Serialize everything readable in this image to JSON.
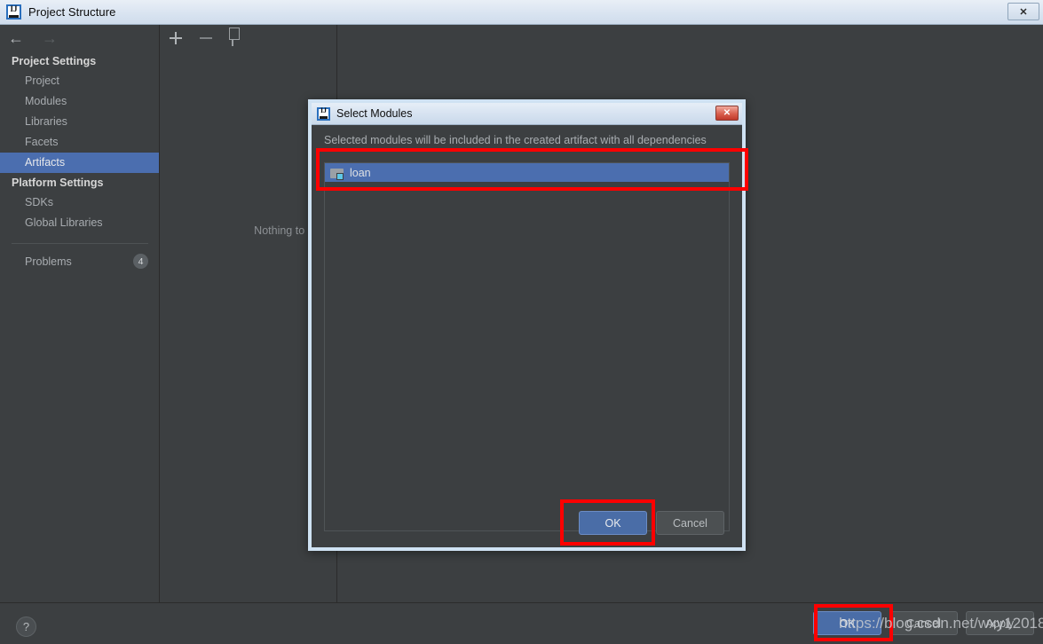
{
  "window": {
    "title": "Project Structure",
    "logo_icon": "intellij-idea-logo-icon",
    "close_icon": "close-icon",
    "close_label": "✕"
  },
  "sidebar": {
    "back_icon": "arrow-left-icon",
    "forward_icon": "arrow-right-icon",
    "back_label": "←",
    "forward_label": "→",
    "groups": [
      {
        "title": "Project Settings",
        "items": [
          {
            "label": "Project",
            "selected": false
          },
          {
            "label": "Modules",
            "selected": false
          },
          {
            "label": "Libraries",
            "selected": false
          },
          {
            "label": "Facets",
            "selected": false
          },
          {
            "label": "Artifacts",
            "selected": true
          }
        ]
      },
      {
        "title": "Platform Settings",
        "items": [
          {
            "label": "SDKs",
            "selected": false
          },
          {
            "label": "Global Libraries",
            "selected": false
          }
        ]
      }
    ],
    "problems": {
      "label": "Problems",
      "count": "4"
    },
    "help": {
      "icon": "question-mark-icon",
      "label": "?"
    }
  },
  "artifacts_pane": {
    "toolbar": [
      {
        "icon": "plus-icon",
        "name": "add-artifact-button"
      },
      {
        "icon": "minus-icon",
        "name": "remove-artifact-button"
      },
      {
        "icon": "copy-icon",
        "name": "copy-artifact-button"
      }
    ],
    "empty_message": "Nothing to show"
  },
  "main_footer": {
    "ok_label": "OK",
    "cancel_label": "Cancel",
    "apply_label": "Apply"
  },
  "dialog": {
    "title": "Select Modules",
    "logo_icon": "intellij-idea-logo-icon",
    "close_icon": "close-icon",
    "close_label": "✕",
    "hint": "Selected modules will be included in the created artifact with all dependencies",
    "modules": [
      {
        "label": "loan",
        "icon": "module-folder-icon",
        "selected": true
      }
    ],
    "ok_label": "OK",
    "cancel_label": "Cancel"
  },
  "annotations": {
    "module_row_highlight": "red-rectangle-module-row",
    "ok_button_highlight": "red-rectangle-dialog-ok",
    "main_ok_highlight": "red-rectangle-main-ok"
  },
  "watermark": {
    "text": "https://blog.csdn.net/wxy12018"
  },
  "colors": {
    "accent_blue": "#4b6eaf",
    "annotation_red": "#fe0000",
    "background": "#3c3f41",
    "dialog_border": "#cfe2f3"
  }
}
